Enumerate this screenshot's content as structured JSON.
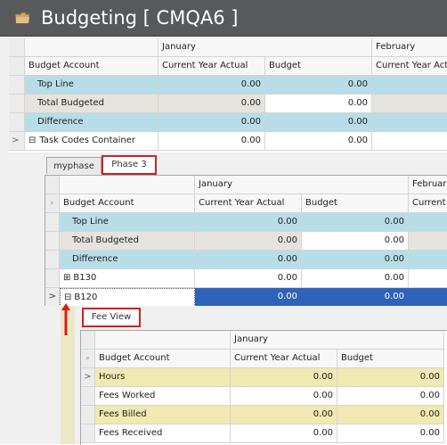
{
  "window": {
    "title": "Budgeting [ CMQA6 ]",
    "title_icon": "folder-icon"
  },
  "grid1": {
    "month_headers": [
      "January",
      "February"
    ],
    "columns": {
      "account": "Budget Account",
      "cya": "Current Year Actual",
      "budget": "Budget",
      "cya2": "Current Year Act"
    },
    "rows": [
      {
        "label": "Top Line",
        "cya": "0.00",
        "budget": "0.00"
      },
      {
        "label": "Total Budgeted",
        "cya": "0.00",
        "budget": "0.00"
      },
      {
        "label": "Difference",
        "cya": "0.00",
        "budget": "0.00"
      },
      {
        "label": "Task Codes Container",
        "cya": "0.00",
        "budget": "0.00"
      }
    ],
    "expand_symbol": "⊟"
  },
  "tabs1": [
    {
      "label": "myphase"
    },
    {
      "label": "Phase 3"
    }
  ],
  "grid2": {
    "month_headers": [
      "January",
      "February"
    ],
    "columns": {
      "account": "Budget Account",
      "cya": "Current Year Actual",
      "budget": "Budget",
      "cya2": "Current"
    },
    "rows": [
      {
        "label": "Top Line",
        "cya": "0.00",
        "budget": "0.00"
      },
      {
        "label": "Total Budgeted",
        "cya": "0.00",
        "budget": "0.00"
      },
      {
        "label": "Difference",
        "cya": "0.00",
        "budget": "0.00"
      },
      {
        "label": "B130",
        "cya": "0.00",
        "budget": "0.00"
      },
      {
        "label": "B120",
        "cya": "0.00",
        "budget": "0.00"
      }
    ],
    "expand_plus": "⊞",
    "expand_minus": "⊟"
  },
  "tabs2": [
    {
      "label": "Fee View"
    }
  ],
  "grid3": {
    "month_headers": [
      "January"
    ],
    "columns": {
      "account": "Budget Account",
      "cya": "Current Year Actual",
      "budget": "Budget"
    },
    "rows": [
      {
        "label": "Hours",
        "cya": "0.00",
        "budget": "0.00"
      },
      {
        "label": "Fees Worked",
        "cya": "0.00",
        "budget": "0.00"
      },
      {
        "label": "Fees Billed",
        "cya": "0.00",
        "budget": "0.00"
      },
      {
        "label": "Fees Received",
        "cya": "0.00",
        "budget": "0.00"
      }
    ]
  },
  "colors": {
    "title_bg": "#58595b",
    "row_blue": "#b7dde8",
    "row_gray": "#e6e3de",
    "row_yellow": "#f0e9b1",
    "selection": "#2f63ba",
    "annotation_red": "#d41f1f"
  }
}
